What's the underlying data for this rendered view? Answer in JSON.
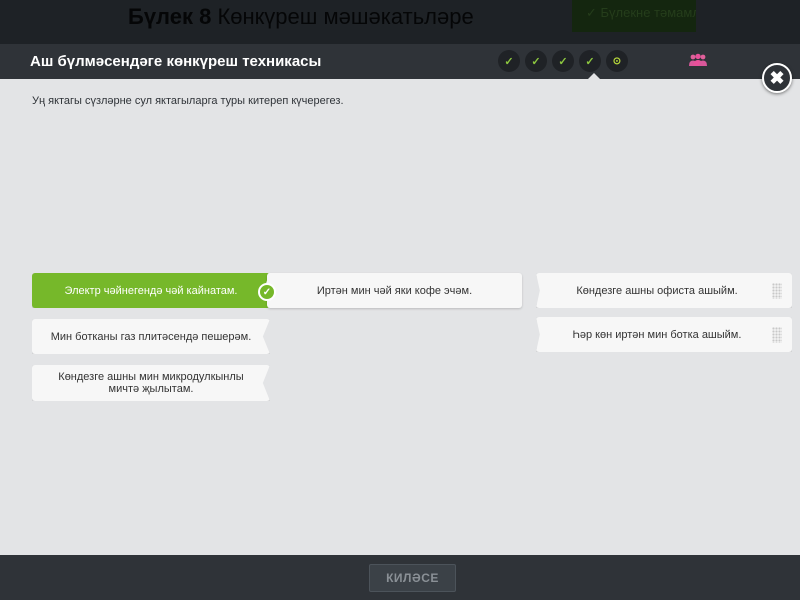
{
  "background_app": {
    "title_bold": "Бүлек 8",
    "title_rest": "Көнкүреш мәшәкатьләре",
    "button_label": "✓ Бүлекне тәмамлау"
  },
  "modal": {
    "title": "Аш бүлмәсендәге көнкүреш техникасы",
    "progress_steps": [
      {
        "icon": "check-icon",
        "symbol": "✓",
        "state": "done"
      },
      {
        "icon": "check-icon",
        "symbol": "✓",
        "state": "done"
      },
      {
        "icon": "check-icon",
        "symbol": "✓",
        "state": "done"
      },
      {
        "icon": "check-icon",
        "symbol": "✓",
        "state": "done"
      },
      {
        "icon": "current-step-icon",
        "symbol": "⊙",
        "state": "current"
      }
    ],
    "people_icon": "people-icon",
    "close_symbol": "✖"
  },
  "instruction": "Уң яктагы сүзләрне сул яктагыларга туры китереп күчерегез.",
  "left_items": [
    {
      "text": "Электр чәйнегендә чәй кайнатам.",
      "matched": true
    },
    {
      "text": "Мин ботканы газ плитәсендә пешерәм.",
      "matched": false
    },
    {
      "text": "Көндезге ашны мин микродулкынлы мичтә җылытам.",
      "matched": false
    }
  ],
  "matched_answer": "Иртән мин чәй яки кофе эчәм.",
  "check_symbol": "✓",
  "right_items": [
    {
      "text": "Көндезге ашны офиста ашыйм."
    },
    {
      "text": "Һәр көн иртән мин ботка ашыйм."
    }
  ],
  "footer": {
    "next_label": "КИЛӘСЕ"
  },
  "colors": {
    "accent_green": "#76b82a",
    "header_dark": "#2f3338",
    "panel_bg": "#e3e4e6"
  }
}
